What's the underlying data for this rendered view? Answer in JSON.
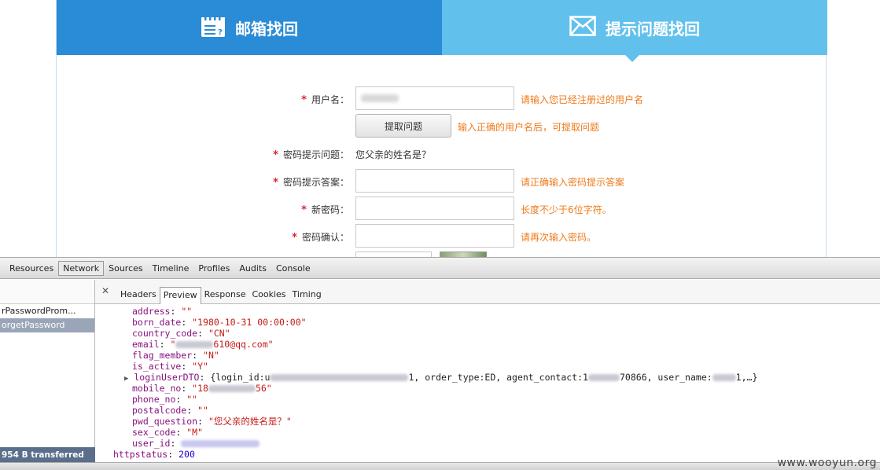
{
  "page": {
    "tabs": [
      {
        "label": "邮箱找回",
        "icon": "calendar-question-icon"
      },
      {
        "label": "提示问题找回",
        "icon": "envelope-icon"
      }
    ],
    "form": {
      "username_label": "用户名：",
      "username_hint": "请输入您已经注册过的用户名",
      "fetch_button": "提取问题",
      "fetch_hint": "输入正确的用户名后，可提取问题",
      "question_label": "密码提示问题：",
      "question_value": "您父亲的姓名是？",
      "answer_label": "密码提示答案：",
      "answer_hint": "请正确输入密码提示答案",
      "newpwd_label": "新密码：",
      "newpwd_hint": "长度不少于6位字符。",
      "confirm_label": "密码确认：",
      "confirm_hint": "请再次输入密码。",
      "required_mark": "*"
    }
  },
  "devtools": {
    "tabs": [
      "Resources",
      "Network",
      "Sources",
      "Timeline",
      "Profiles",
      "Audits",
      "Console"
    ],
    "active_tab": "Network",
    "requests": [
      "rPasswordProm...",
      "orgetPassword"
    ],
    "transferred": "954 B transferred",
    "subtabs": [
      "Headers",
      "Preview",
      "Response",
      "Cookies",
      "Timing"
    ],
    "active_subtab": "Preview",
    "preview": {
      "address": "\"\"",
      "born_date": "\"1980-10-31 00:00:00\"",
      "country_code": "\"CN\"",
      "email_suffix": "610@qq.com\"",
      "flag_member": "\"N\"",
      "is_active": "\"Y\"",
      "login_prefix": "{login_id:u",
      "login_mid": "1, order_type:ED, agent_contact:1",
      "login_mid2": "70866, user_name:",
      "login_end": "1,…}",
      "mobile_prefix": "\"18",
      "mobile_suffix": "56\"",
      "phone_no": "\"\"",
      "postalcode": "\"\"",
      "pwd_question": "\"您父亲的姓名是？\"",
      "sex_code": "\"M\"",
      "httpstatus": "200"
    }
  },
  "watermark": "www.wooyun.org"
}
